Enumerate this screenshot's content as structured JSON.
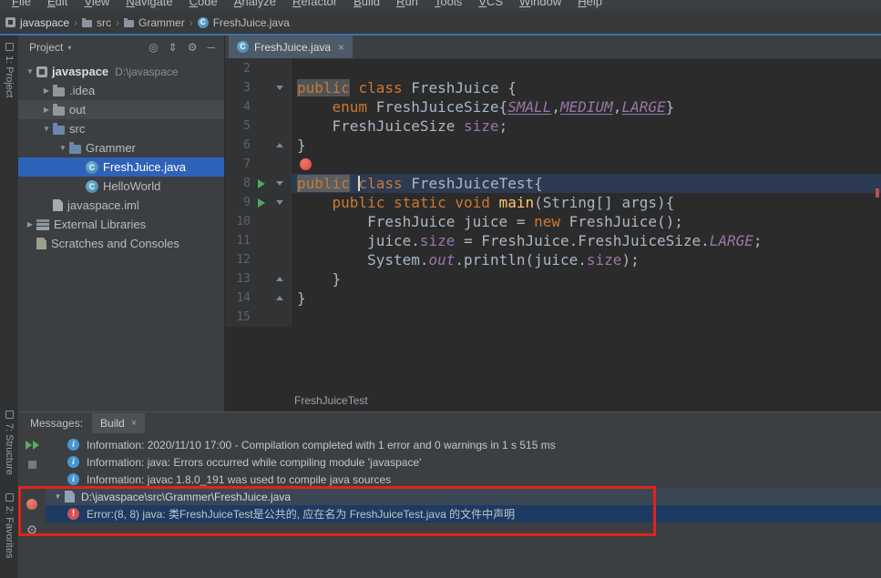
{
  "menu": {
    "items": [
      "File",
      "Edit",
      "View",
      "Navigate",
      "Code",
      "Analyze",
      "Refactor",
      "Build",
      "Run",
      "Tools",
      "VCS",
      "Window",
      "Help"
    ]
  },
  "breadcrumb": {
    "items": [
      "javaspace",
      "src",
      "Grammer",
      "FreshJuice.java"
    ]
  },
  "left_stripe": {
    "project": "1: Project",
    "structure": "7: Structure",
    "favorites": "2: Favorites"
  },
  "project_panel": {
    "title": "Project",
    "tree": [
      {
        "label": "javaspace",
        "path": "D:\\javaspace"
      },
      {
        "label": ".idea"
      },
      {
        "label": "out"
      },
      {
        "label": "src"
      },
      {
        "label": "Grammer"
      },
      {
        "label": "FreshJuice.java"
      },
      {
        "label": "HelloWorld"
      },
      {
        "label": "javaspace.iml"
      },
      {
        "label": "External Libraries"
      },
      {
        "label": "Scratches and Consoles"
      }
    ]
  },
  "editor": {
    "tab": "FreshJuice.java",
    "breadcrumb": "FreshJuiceTest",
    "lines": [
      {
        "n": "2",
        "s": []
      },
      {
        "n": "3",
        "s": [
          "public",
          " ",
          "class",
          " FreshJuice {"
        ]
      },
      {
        "n": "4",
        "s": [
          "    ",
          "enum",
          " FreshJuiceSize{",
          "SMALL",
          ",",
          "MEDIUM",
          ",",
          "LARGE",
          "}"
        ]
      },
      {
        "n": "5",
        "s": [
          "    FreshJuiceSize ",
          "size",
          ";"
        ]
      },
      {
        "n": "6",
        "s": [
          "}"
        ]
      },
      {
        "n": "7",
        "s": []
      },
      {
        "n": "8",
        "s": [
          "public",
          " ",
          "class",
          " FreshJuiceTest{"
        ]
      },
      {
        "n": "9",
        "s": [
          "    ",
          "public",
          " ",
          "static",
          " ",
          "void",
          " ",
          "main",
          "(String[] args){"
        ]
      },
      {
        "n": "10",
        "s": [
          "        FreshJuice juice = ",
          "new",
          " FreshJuice();"
        ]
      },
      {
        "n": "11",
        "s": [
          "        juice.",
          "size",
          " = FreshJuice.FreshJuiceSize.",
          "LARGE",
          ";"
        ]
      },
      {
        "n": "12",
        "s": [
          "        System.",
          "out",
          ".println(juice.",
          "size",
          ");"
        ]
      },
      {
        "n": "13",
        "s": [
          "    }"
        ]
      },
      {
        "n": "14",
        "s": [
          "}"
        ]
      },
      {
        "n": "15",
        "s": []
      }
    ]
  },
  "messages": {
    "label": "Messages:",
    "tab": "Build",
    "rows": [
      "Information: 2020/11/10 17:00 - Compilation completed with 1 error and 0 warnings in 1 s 515 ms",
      "Information: java: Errors occurred while compiling module 'javaspace'",
      "Information: javac 1.8.0_191 was used to compile java sources",
      "D:\\javaspace\\src\\Grammer\\FreshJuice.java",
      "Error:(8, 8)  java: 类FreshJuiceTest是公共的, 应在名为 FreshJuiceTest.java 的文件中声明"
    ]
  },
  "icons": {
    "class_letter": "C",
    "info_letter": "i",
    "error_mark": "!",
    "expand": "▼",
    "collapse": "▶",
    "close": "×",
    "gear": "⚙",
    "locate": "◎",
    "updown": "⇕",
    "minus": "─",
    "chevron": "›",
    "header_caret": "▾"
  },
  "colors": {
    "accent_line": "#3a6fb5",
    "selection": "#2d62b8",
    "keyword": "#cc7832",
    "member": "#9876aa",
    "method": "#ffc66b",
    "editor_bg": "#2b2b2b",
    "annotation": "#e0241b"
  }
}
